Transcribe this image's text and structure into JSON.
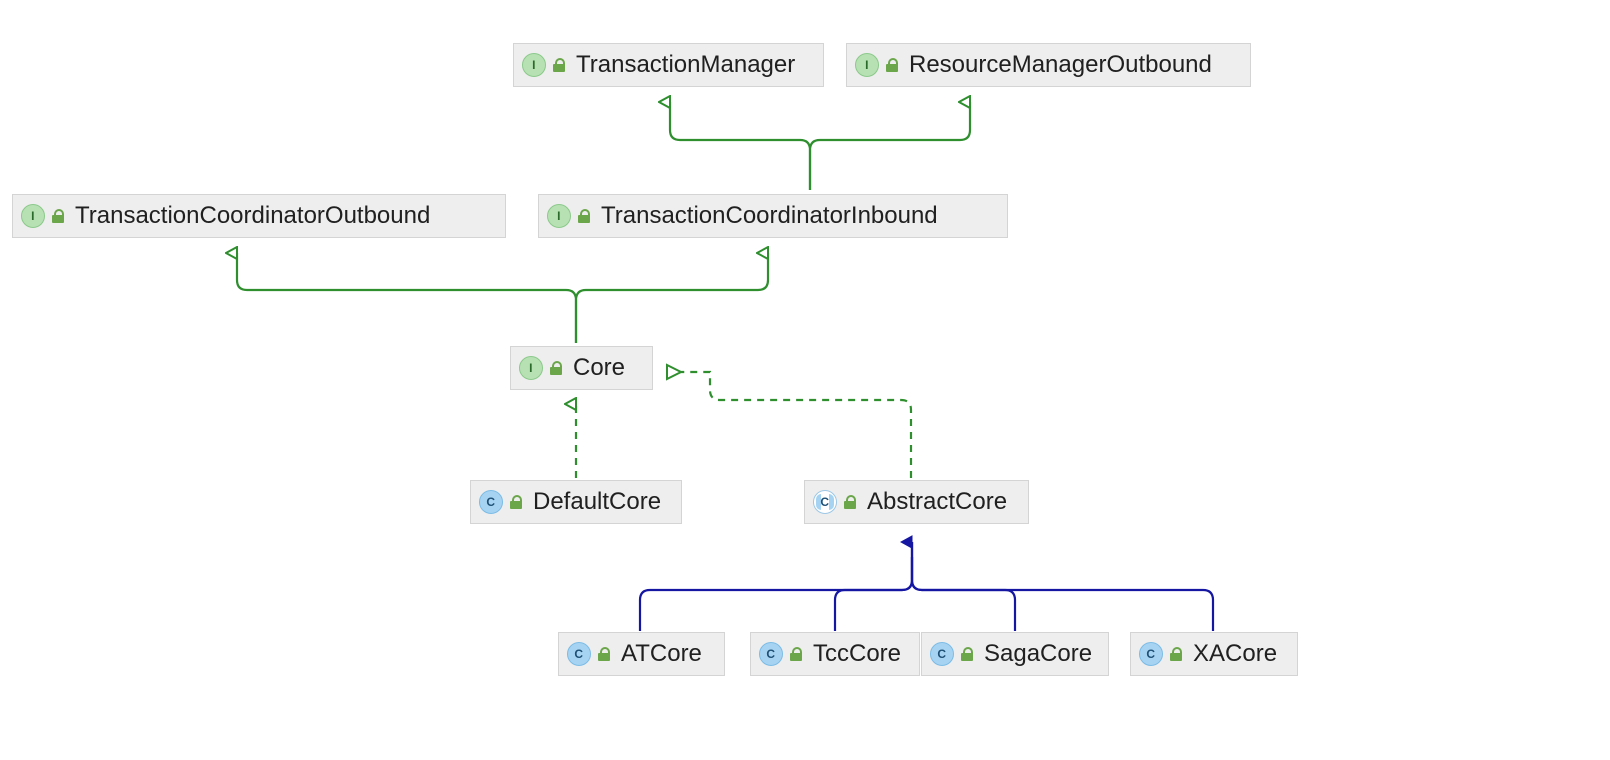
{
  "nodes": {
    "txnManager": {
      "label": "TransactionManager",
      "kind": "interface"
    },
    "resMgrOutbound": {
      "label": "ResourceManagerOutbound",
      "kind": "interface"
    },
    "txnCoordOutbound": {
      "label": "TransactionCoordinatorOutbound",
      "kind": "interface"
    },
    "txnCoordInbound": {
      "label": "TransactionCoordinatorInbound",
      "kind": "interface"
    },
    "core": {
      "label": "Core",
      "kind": "interface"
    },
    "defaultCore": {
      "label": "DefaultCore",
      "kind": "class"
    },
    "abstractCore": {
      "label": "AbstractCore",
      "kind": "abstract"
    },
    "atCore": {
      "label": "ATCore",
      "kind": "class"
    },
    "tccCore": {
      "label": "TccCore",
      "kind": "class"
    },
    "sagaCore": {
      "label": "SagaCore",
      "kind": "class"
    },
    "xaCore": {
      "label": "XACore",
      "kind": "class"
    }
  },
  "badge_letters": {
    "interface": "I",
    "class": "C",
    "abstract": "C"
  },
  "relations": [
    {
      "from": "txnCoordInbound",
      "to": "txnManager",
      "type": "extends-interface"
    },
    {
      "from": "txnCoordInbound",
      "to": "resMgrOutbound",
      "type": "extends-interface"
    },
    {
      "from": "core",
      "to": "txnCoordOutbound",
      "type": "extends-interface"
    },
    {
      "from": "core",
      "to": "txnCoordInbound",
      "type": "extends-interface"
    },
    {
      "from": "defaultCore",
      "to": "core",
      "type": "implements"
    },
    {
      "from": "abstractCore",
      "to": "core",
      "type": "implements"
    },
    {
      "from": "atCore",
      "to": "abstractCore",
      "type": "extends-class"
    },
    {
      "from": "tccCore",
      "to": "abstractCore",
      "type": "extends-class"
    },
    {
      "from": "sagaCore",
      "to": "abstractCore",
      "type": "extends-class"
    },
    {
      "from": "xaCore",
      "to": "abstractCore",
      "type": "extends-class"
    }
  ],
  "colors": {
    "interface_line": "#2f8f2f",
    "class_line": "#1517a3"
  }
}
